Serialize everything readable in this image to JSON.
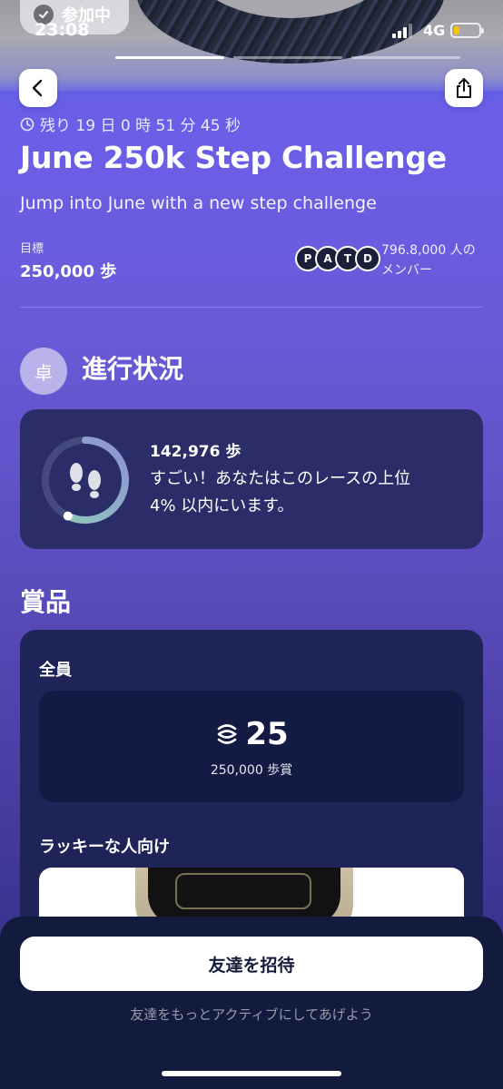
{
  "status_bar": {
    "joined_label": "参加中",
    "time": "23:08",
    "network": "4G"
  },
  "challenge": {
    "countdown": "残り 19 日 0 時 51 分 45 秒",
    "title": "June 250k Step Challenge",
    "subtitle": "Jump into June with a new step challenge",
    "goal_label": "目標",
    "goal_value": "250,000 歩",
    "member_initials": [
      "P",
      "A",
      "T",
      "D"
    ],
    "members_line1": "796.8,000 人の",
    "members_line2": "メンバー"
  },
  "progress": {
    "badge": "卓",
    "title": "進行状況",
    "steps": "142,976 歩",
    "rank_line1": "すごい！あなたはこのレースの上位",
    "rank_line2": "4% 以内にいます。",
    "fraction": 0.572
  },
  "prizes": {
    "title": "賞品",
    "everyone_label": "全員",
    "coin_amount": "25",
    "prize_caption": "250,000 歩賞",
    "lucky_label": "ラッキーな人向け"
  },
  "footer": {
    "invite_button": "友達を招待",
    "invite_hint": "友達をもっとアクティブにしてあげよう"
  },
  "colors": {
    "accent": "#6a5ad8",
    "card": "#2b2d68",
    "ring_track": "#454a7e",
    "ring_progress": "#8fd0b7"
  }
}
